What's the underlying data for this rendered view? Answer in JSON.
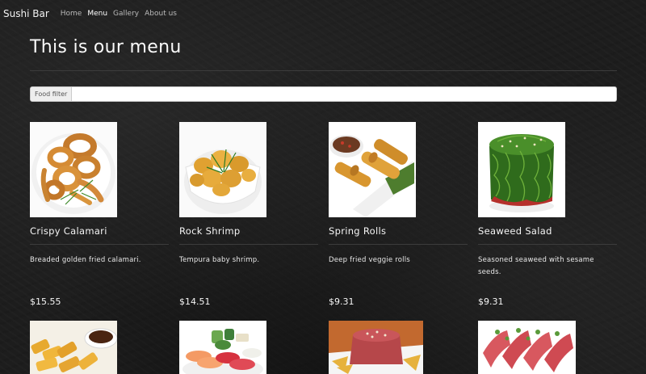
{
  "nav": {
    "brand": "Sushi Bar",
    "links": [
      {
        "label": "Home",
        "active": false
      },
      {
        "label": "Menu",
        "active": true
      },
      {
        "label": "Gallery",
        "active": false
      },
      {
        "label": "About us",
        "active": false
      }
    ]
  },
  "page": {
    "title": "This is our menu"
  },
  "filter": {
    "label": "Food filter",
    "value": "",
    "placeholder": ""
  },
  "menu": [
    {
      "name": "Crispy Calamari",
      "description": "Breaded golden fried calamari.",
      "price": "$15.55",
      "image": "fried-calamari-photo"
    },
    {
      "name": "Rock Shrimp",
      "description": "Tempura baby shrimp.",
      "price": "$14.51",
      "image": "tempura-shrimp-photo"
    },
    {
      "name": "Spring Rolls",
      "description": "Deep fried veggie rolls",
      "price": "$9.31",
      "image": "spring-rolls-photo"
    },
    {
      "name": "Seaweed Salad",
      "description": "Seasoned seaweed with sesame seeds.",
      "price": "$9.31",
      "image": "seaweed-salad-photo"
    }
  ],
  "second_row_images": [
    "fried-tofu-photo",
    "sashimi-platter-photo",
    "tuna-tartare-photo",
    "seared-tuna-photo"
  ],
  "colors": {
    "background": "#1d1d1d",
    "text": "#ffffff",
    "nav_inactive": "#b9b9b9",
    "divider": "#3c3c3c"
  }
}
